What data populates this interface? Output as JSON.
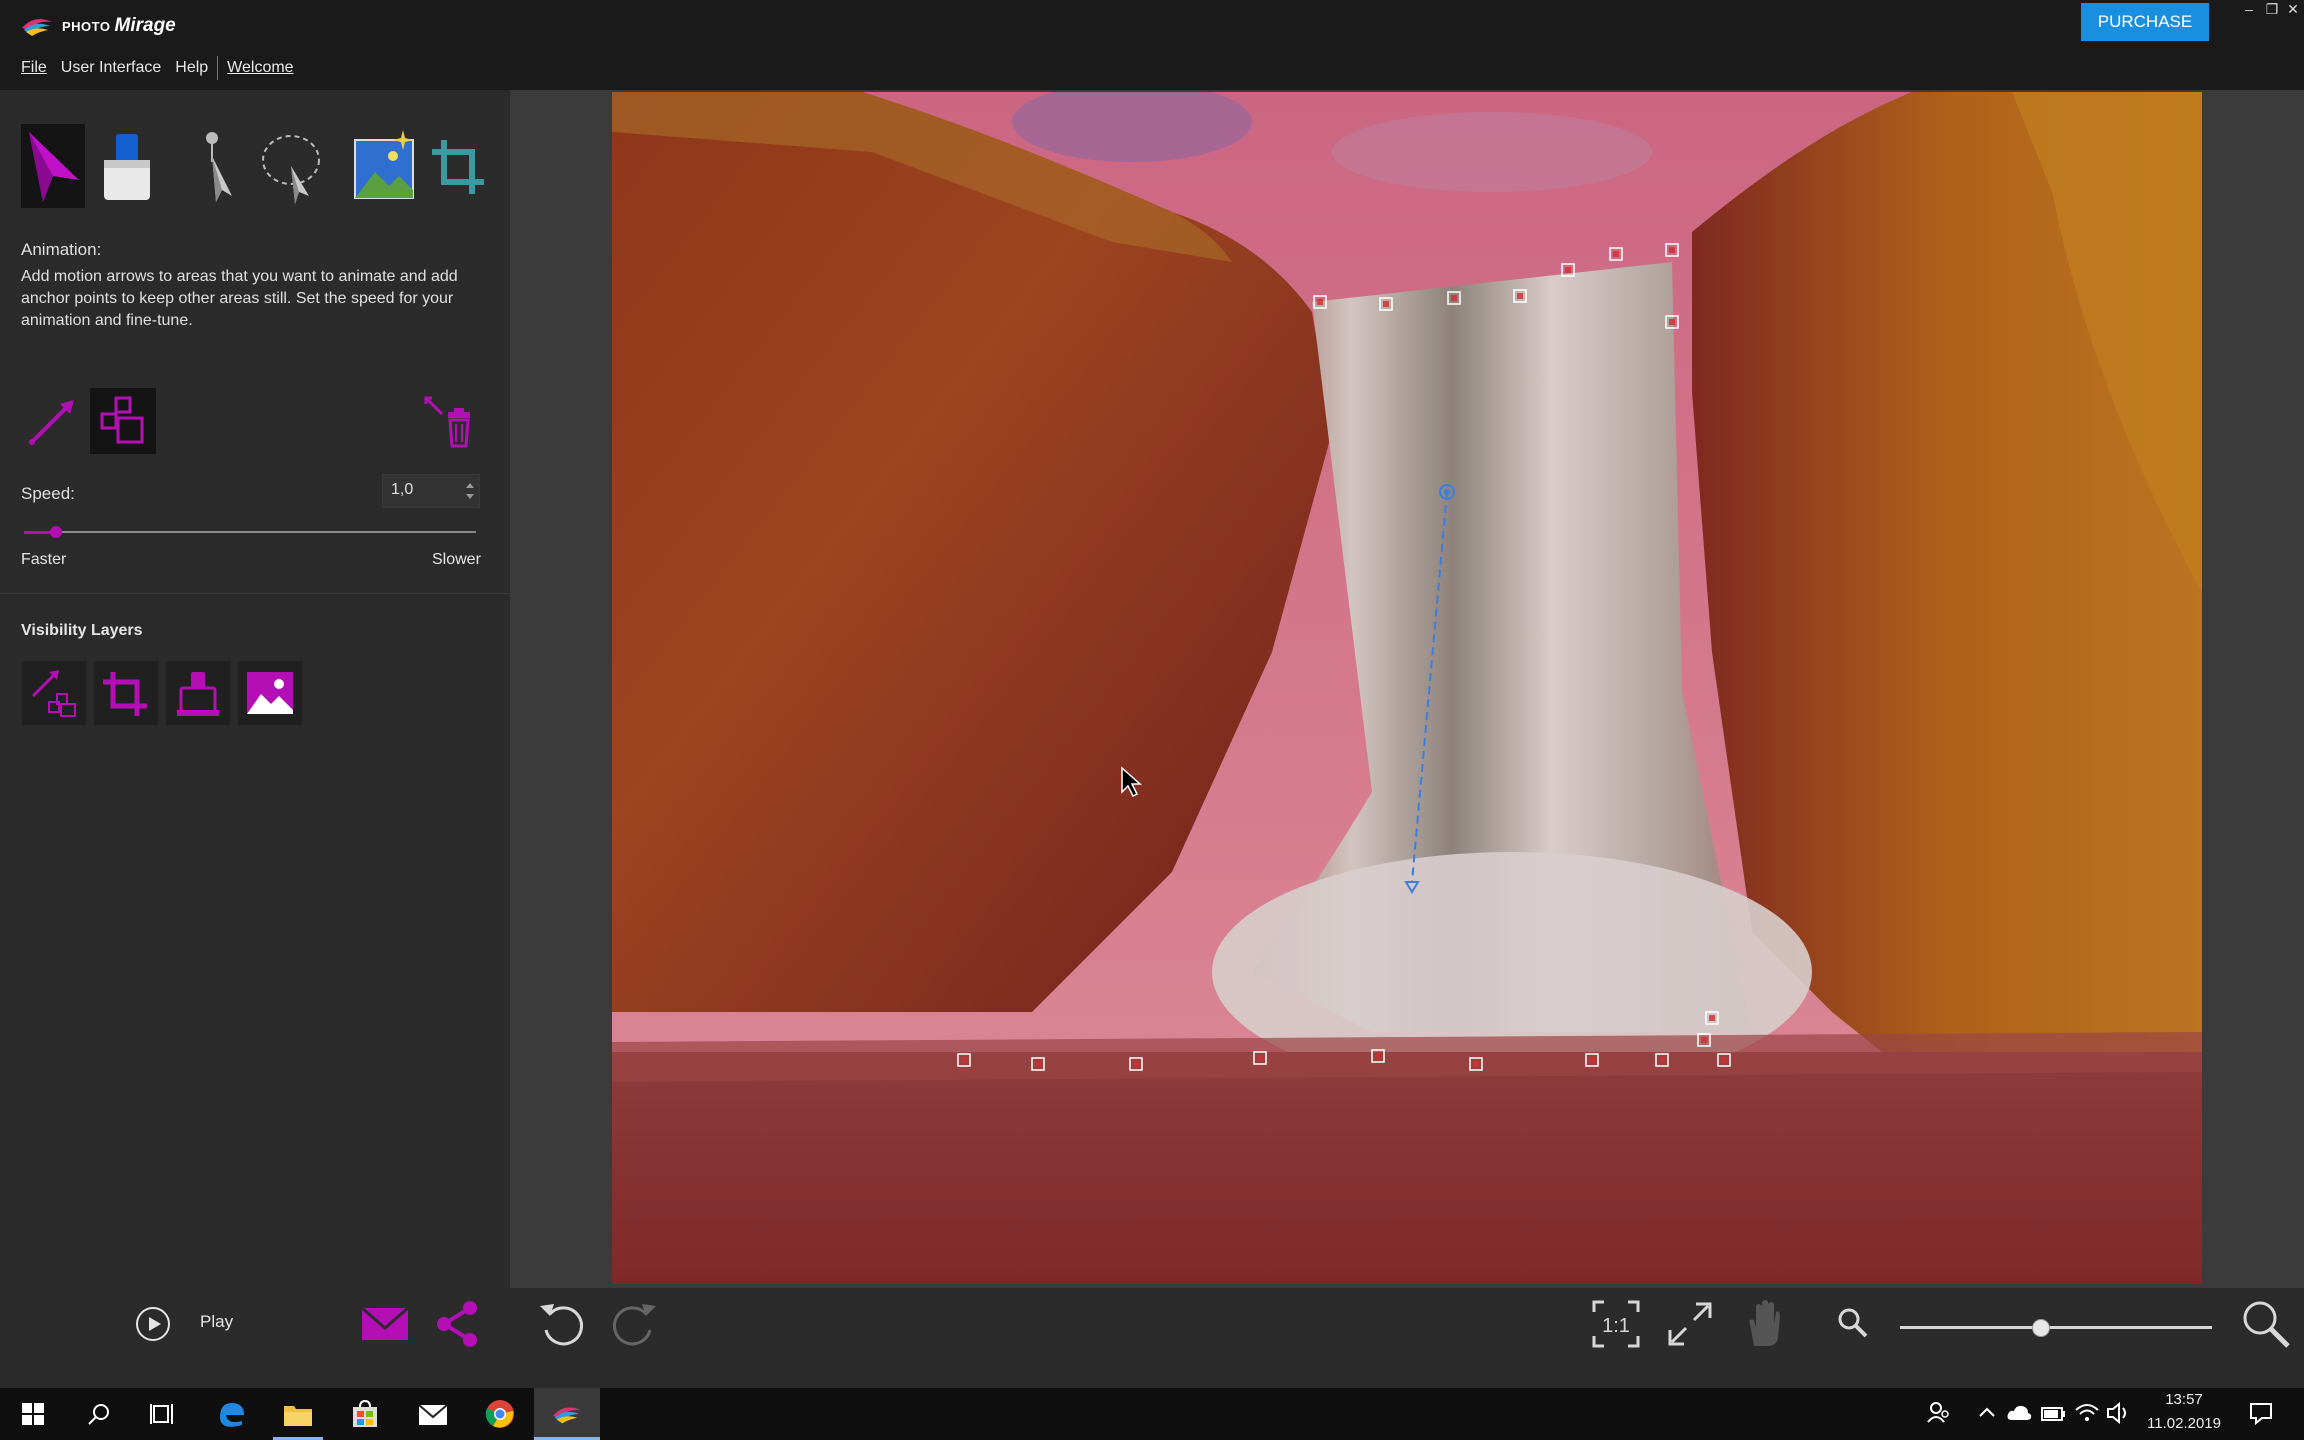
{
  "app": {
    "logo_small": "PHOTO",
    "logo_big": "Mirage",
    "purchase_label": "PURCHASE"
  },
  "window_controls": [
    "–",
    "❐",
    "✕"
  ],
  "menu": {
    "items": [
      {
        "label": "File"
      },
      {
        "label": "User Interface"
      },
      {
        "label": "Help"
      },
      {
        "label": "Welcome"
      }
    ]
  },
  "tools": {
    "top": [
      {
        "name": "animation-tool",
        "icon": "arrow-icon",
        "selected": true
      },
      {
        "name": "eraser-tool",
        "icon": "eraser-icon",
        "selected": false
      },
      {
        "name": "select-tool",
        "icon": "pointer-pin-icon",
        "selected": false
      },
      {
        "name": "lasso-select-tool",
        "icon": "lasso-icon",
        "selected": false
      },
      {
        "name": "image-tool",
        "icon": "image-icon",
        "selected": false
      },
      {
        "name": "crop-tool",
        "icon": "crop-icon",
        "selected": false
      }
    ],
    "sub": [
      {
        "name": "motion-arrow-tool",
        "icon": "motion-arrow-icon",
        "selected": false
      },
      {
        "name": "anchor-point-tool",
        "icon": "anchor-points-icon",
        "selected": true
      },
      {
        "name": "delete-tool",
        "icon": "trash-icon",
        "selected": false
      }
    ]
  },
  "animation": {
    "title": "Animation:",
    "description": "Add motion arrows to areas that you want to animate and add anchor points to keep other areas still. Set the speed for your animation and fine-tune."
  },
  "speed": {
    "label": "Speed:",
    "value": "1,0",
    "slider_fraction": 0.07,
    "min_label": "Faster",
    "max_label": "Slower"
  },
  "visibility": {
    "title": "Visibility Layers",
    "layers": [
      "arrows-layer-icon",
      "crop-layer-icon",
      "mask-layer-icon",
      "image-layer-icon"
    ]
  },
  "bottom": {
    "play_label": "Play",
    "zoom_fraction": 0.45
  },
  "taskbar": {
    "time": "13:57",
    "date": "11.02.2019"
  },
  "colors": {
    "accent": "#b30fb5",
    "purchase": "#1a8fe0",
    "anchor": "#d03030",
    "motion_arrow": "#3a7fe0"
  }
}
